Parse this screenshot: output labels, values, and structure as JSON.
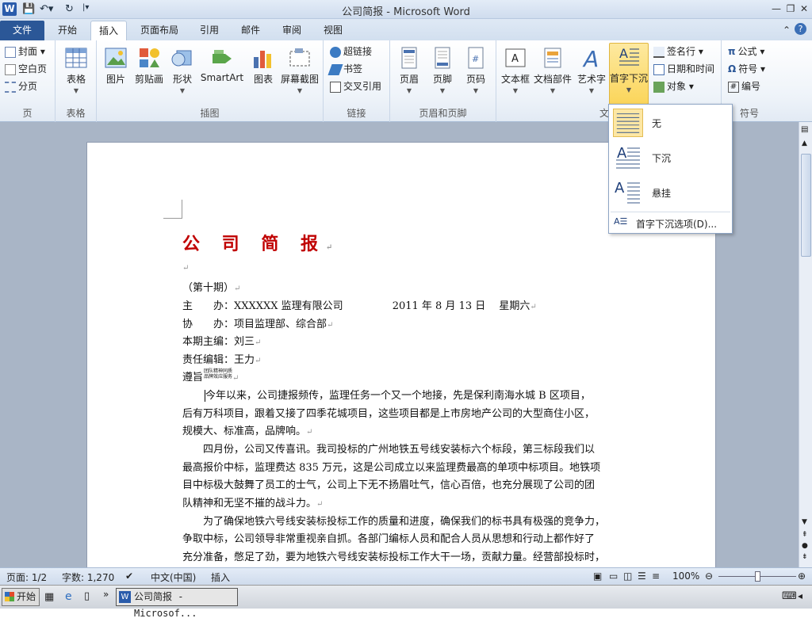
{
  "app": {
    "title": "公司简报 - Microsoft Word",
    "logo_letter": "W",
    "accent_color": "#2b5797"
  },
  "tabs": [
    {
      "label": "文件"
    },
    {
      "label": "开始"
    },
    {
      "label": "插入"
    },
    {
      "label": "页面布局"
    },
    {
      "label": "引用"
    },
    {
      "label": "邮件"
    },
    {
      "label": "审阅"
    },
    {
      "label": "视图"
    }
  ],
  "ribbon": {
    "page_group": {
      "label": "页",
      "cover": "封面",
      "blank": "空白页",
      "break": "分页"
    },
    "table_group": {
      "label": "表格",
      "table": "表格"
    },
    "illustration_group": {
      "label": "插图",
      "picture": "图片",
      "clipart": "剪贴画",
      "shapes": "形状",
      "smartart": "SmartArt",
      "chart": "图表",
      "screenshot": "屏幕截图"
    },
    "link_group": {
      "label": "链接",
      "hyperlink": "超链接",
      "bookmark": "书签",
      "crossref": "交叉引用"
    },
    "header_group": {
      "label": "页眉和页脚",
      "header": "页眉",
      "footer": "页脚",
      "pagenum": "页码"
    },
    "text_group": {
      "label": "文",
      "textbox": "文本框",
      "quickparts": "文档部件",
      "wordart": "艺术字",
      "dropcap": "首字下沉",
      "signature": "签名行",
      "datetime": "日期和时间",
      "object": "对象"
    },
    "symbol_group": {
      "label": "符号",
      "equation": "公式",
      "symbol": "符号",
      "number": "编号"
    }
  },
  "dropcap_menu": {
    "none": "无",
    "dropped": "下沉",
    "margin": "悬挂",
    "options": "首字下沉选项(D)..."
  },
  "document": {
    "title": "公 司 简 报",
    "issue": "（第十期）",
    "host_label": "主　　办：",
    "host": "XXXXXX 监理有限公司",
    "date": "2011 年 8 月 13 日　 星期六",
    "cohost_label": "协　　办：",
    "cohost": "项目监理部、综合部",
    "editor_label": "本期主编：",
    "editor": "刘三",
    "responsible_label": "责任编辑：",
    "responsible": "王力",
    "motto_label": "遵旨",
    "motto_small_1": "团队精神同质",
    "motto_small_2": "品牌效应服务",
    "paragraphs": [
      "今年以来，公司捷报频传，监理任务一个又一个地接，先是保利南海水城 B 区项目，",
      "后有万科项目，跟着又接了四季花城项目，这些项目都是上市房地产公司的大型商住小区，",
      "规模大、标准高，品牌响。",
      "　　四月份，公司又传喜讯。我司投标的广州地铁五号线安装标六个标段，第三标段我们以",
      "最高报价中标，监理费达 835 万元，这是公司成立以来监理费最高的单项中标项目。地铁项",
      "目中标极大鼓舞了员工的士气，公司上下无不扬眉吐气，信心百倍，也充分展现了公司的团",
      "队精神和无坚不摧的战斗力。",
      "　　为了确保地铁六号线安装标投标工作的质量和进度，确保我们的标书具有极强的竞争力，",
      "争取中标，公司领导非常重视亲自抓。各部门编标人员和配合人员从思想和行动上都作好了",
      "充分准备，憋足了劲，要为地铁六号线安装标投标工作大干一场，贡献力量。经营部投标时，"
    ]
  },
  "status": {
    "page": "页面: 1/2",
    "words": "字数: 1,270",
    "lang": "中文(中国)",
    "mode": "插入",
    "zoom": "100%"
  },
  "taskbar": {
    "start": "开始",
    "window": "公司简报 - Microsof..."
  }
}
